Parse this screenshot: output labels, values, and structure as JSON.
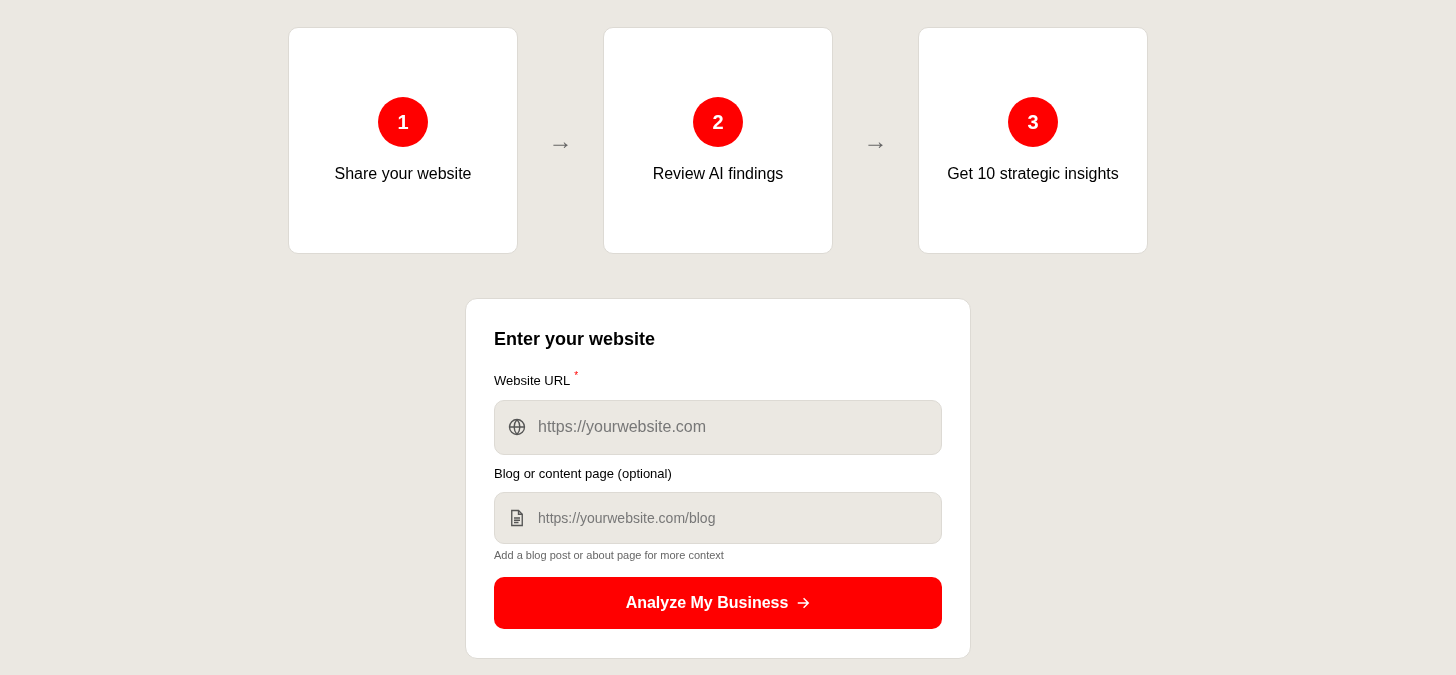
{
  "steps": [
    {
      "number": "1",
      "label": "Share your website"
    },
    {
      "number": "2",
      "label": "Review AI findings"
    },
    {
      "number": "3",
      "label": "Get 10 strategic insights"
    }
  ],
  "step_separator": "→",
  "form": {
    "title": "Enter your website",
    "fields": [
      {
        "kind": "website",
        "label": "Website URL",
        "required_mark": "*",
        "placeholder": "https://yourwebsite.com"
      },
      {
        "kind": "page",
        "label": "Blog or content page (optional)",
        "placeholder": "https://yourwebsite.com/blog",
        "help": "Add a blog post or about page for more context"
      }
    ],
    "submit": "Analyze My Business"
  }
}
